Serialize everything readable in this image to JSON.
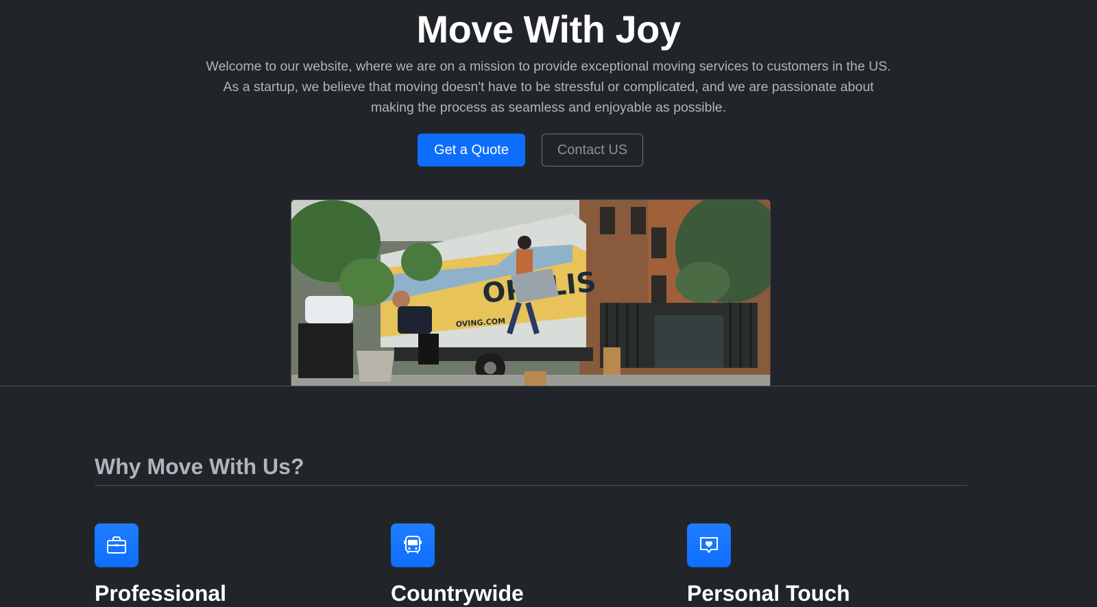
{
  "hero": {
    "title": "Move With Joy",
    "lead": "Welcome to our website, where we are on a mission to provide exceptional moving services to customers in the US. As a startup, we believe that moving doesn't have to be stressful or complicated, and we are passionate about making the process as seamless and enjoyable as possible.",
    "primary_button": "Get a Quote",
    "secondary_button": "Contact US",
    "truck_text": "OPOLIS",
    "truck_subtext": "OVING.COM"
  },
  "features": {
    "heading": "Why Move With Us?",
    "items": [
      {
        "icon": "briefcase-icon",
        "title": "Professional"
      },
      {
        "icon": "bus-icon",
        "title": "Countrywide"
      },
      {
        "icon": "chat-heart-icon",
        "title": "Personal Touch"
      }
    ]
  },
  "colors": {
    "background": "#212529",
    "accent": "#0d6efd",
    "muted_text": "#adb5bd"
  }
}
